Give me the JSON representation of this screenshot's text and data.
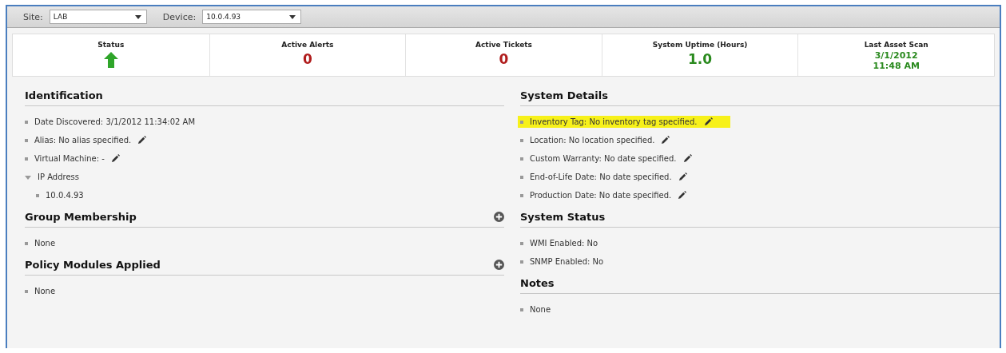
{
  "toolbar": {
    "site": {
      "label": "Site:",
      "value": "LAB"
    },
    "device": {
      "label": "Device:",
      "value": "10.0.4.93"
    }
  },
  "stats": [
    {
      "label": "Status",
      "kind": "status",
      "up": true
    },
    {
      "label": "Active Alerts",
      "kind": "value",
      "lines": [
        "0"
      ],
      "color": "#b01c1c"
    },
    {
      "label": "Active Tickets",
      "kind": "value",
      "lines": [
        "0"
      ],
      "color": "#b01c1c"
    },
    {
      "label": "System Uptime (Hours)",
      "kind": "value",
      "lines": [
        "1.0"
      ],
      "color": "#2a8a1e"
    },
    {
      "label": "Last Asset Scan",
      "kind": "small",
      "lines": [
        "3/1/2012",
        "11:48 AM"
      ],
      "color": "#2a8a1e"
    }
  ],
  "columns": [
    [
      {
        "title": "Identification",
        "addable": false,
        "items": [
          {
            "text": "Date Discovered: 3/1/2012 11:34:02 AM",
            "editable": false,
            "highlighted": false
          },
          {
            "text": "Alias: No alias specified.",
            "editable": true,
            "highlighted": false
          },
          {
            "text": "Virtual Machine: -",
            "editable": true,
            "highlighted": false
          },
          {
            "text": "IP Address",
            "editable": false,
            "highlighted": false,
            "expanded": true,
            "children": [
              {
                "text": "10.0.4.93",
                "editable": false,
                "highlighted": false
              }
            ]
          }
        ]
      },
      {
        "title": "Group Membership",
        "addable": true,
        "items": [
          {
            "text": "None",
            "editable": false,
            "highlighted": false
          }
        ]
      },
      {
        "title": "Policy Modules Applied",
        "addable": true,
        "items": [
          {
            "text": "None",
            "editable": false,
            "highlighted": false
          }
        ]
      }
    ],
    [
      {
        "title": "System Details",
        "addable": false,
        "items": [
          {
            "text": "Inventory Tag: No inventory tag specified.",
            "editable": true,
            "highlighted": true
          },
          {
            "text": "Location: No location specified.",
            "editable": true,
            "highlighted": false
          },
          {
            "text": "Custom Warranty: No date specified.",
            "editable": true,
            "highlighted": false
          },
          {
            "text": "End-of-Life Date: No date specified.",
            "editable": true,
            "highlighted": false
          },
          {
            "text": "Production Date: No date specified.",
            "editable": true,
            "highlighted": false
          }
        ]
      },
      {
        "title": "System Status",
        "addable": false,
        "items": [
          {
            "text": "WMI Enabled: No",
            "editable": false,
            "highlighted": false
          },
          {
            "text": "SNMP Enabled: No",
            "editable": false,
            "highlighted": false
          }
        ]
      },
      {
        "title": "Notes",
        "addable": false,
        "items": [
          {
            "text": "None",
            "editable": false,
            "highlighted": false
          }
        ]
      }
    ]
  ]
}
